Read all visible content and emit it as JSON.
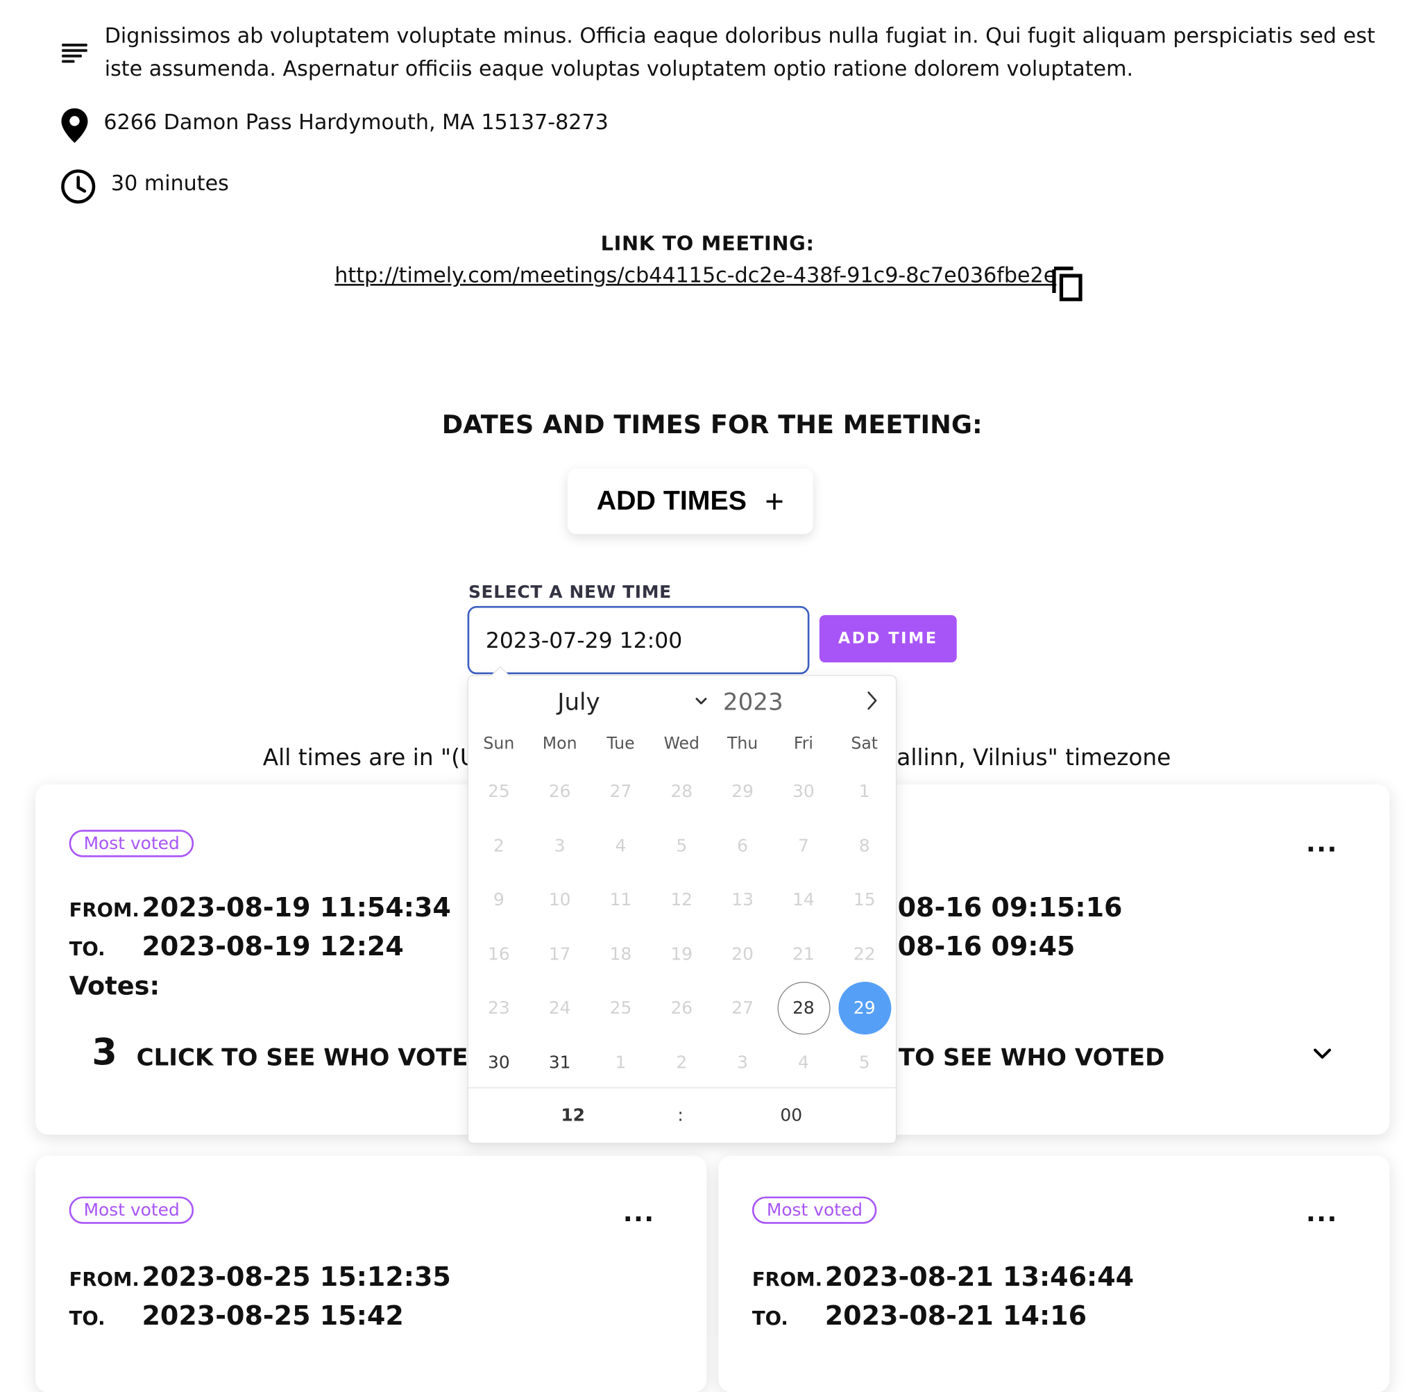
{
  "meeting": {
    "description": "Dignissimos ab voluptatem voluptate minus. Officia eaque doloribus nulla fugiat in. Qui fugit aliquam perspiciatis sed est iste assumenda. Aspernatur officiis eaque voluptas voluptatem optio ratione dolorem voluptatem.",
    "location": "6266 Damon Pass Hardymouth, MA 15137-8273",
    "duration": "30 minutes",
    "link_label": "LINK TO MEETING:",
    "link_url": "http://timely.com/meetings/cb44115c-dc2e-438f-91c9-8c7e036fbe2e"
  },
  "icons": {
    "description": "notes-icon",
    "location": "location-pin-icon",
    "duration": "clock-icon",
    "copy": "copy-icon"
  },
  "dates_section": {
    "title": "DATES AND TIMES FOR THE MEETING:",
    "add_times_label": "ADD TIMES",
    "add_times_icon": "+",
    "select_label": "SELECT A NEW TIME",
    "input_value": "2023-07-29 12:00",
    "add_time_button": "ADD TIME",
    "timezone_left": "All times are in \"(U",
    "timezone_right": "allinn, Vilnius\" timezone"
  },
  "calendar": {
    "month": "July",
    "year": "2023",
    "weekdays": [
      "Sun",
      "Mon",
      "Tue",
      "Wed",
      "Thu",
      "Fri",
      "Sat"
    ],
    "weeks": [
      [
        "25",
        "26",
        "27",
        "28",
        "29",
        "30",
        "1"
      ],
      [
        "2",
        "3",
        "4",
        "5",
        "6",
        "7",
        "8"
      ],
      [
        "9",
        "10",
        "11",
        "12",
        "13",
        "14",
        "15"
      ],
      [
        "16",
        "17",
        "18",
        "19",
        "20",
        "21",
        "22"
      ],
      [
        "23",
        "24",
        "25",
        "26",
        "27",
        "28",
        "29"
      ],
      [
        "30",
        "31",
        "1",
        "2",
        "3",
        "4",
        "5"
      ]
    ],
    "today": "28",
    "selected": "29",
    "hour": "12",
    "separator": ":",
    "minute": "00"
  },
  "cards": [
    {
      "badge": "Most voted",
      "more": "...",
      "from_label": "FROM.",
      "from": "2023-08-19 11:54:34",
      "to_label": "TO.",
      "to": "2023-08-19 12:24",
      "votes_label": "Votes:",
      "vote_count": "3",
      "see_who": "CLICK TO SEE WHO VOTED"
    },
    {
      "from": "-08-16 09:15:16",
      "to": "-08-16 09:45",
      "see_who": "TO SEE WHO VOTED",
      "more": "..."
    },
    {
      "badge": "Most voted",
      "more": "...",
      "from_label": "FROM.",
      "from": "2023-08-25 15:12:35",
      "to_label": "TO.",
      "to": "2023-08-25 15:42"
    },
    {
      "badge": "Most voted",
      "more": "...",
      "from_label": "FROM.",
      "from": "2023-08-21 13:46:44",
      "to_label": "TO.",
      "to": "2023-08-21 14:16"
    }
  ],
  "colors": {
    "accent": "#a855f7",
    "selected_day": "#569ff7",
    "input_border": "#3b5fc0"
  }
}
